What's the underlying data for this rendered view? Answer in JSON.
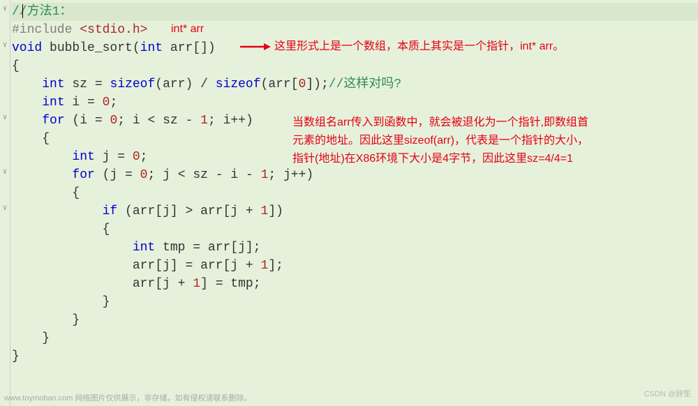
{
  "annotations": {
    "topLabel": "int* arr",
    "arrowNote": "这里形式上是一个数组，本质上其实是一个指针，int* arr。",
    "para1": "当数组名arr传入到函数中，就会被退化为一个指针,即数组首",
    "para2": "元素的地址。因此这里sizeof(arr)，代表是一个指针的大小，",
    "para3": "指针(地址)在X86环境下大小是4字节，因此这里sz=4/4=1"
  },
  "code": {
    "l1": {
      "a": "//方法1："
    },
    "l2": {
      "a": "#include ",
      "b": "<stdio.h>"
    },
    "l3": {
      "a": "void",
      "b": " bubble_sort",
      "c": "(",
      "d": "int",
      "e": " arr",
      "f": "[])"
    },
    "l4": {
      "a": "{"
    },
    "l5": {
      "a": "    ",
      "b": "int",
      "c": " sz ",
      "d": "=",
      "e": " ",
      "f": "sizeof",
      "g": "(arr) ",
      "h": "/",
      "i": " ",
      "j": "sizeof",
      "k": "(arr[",
      "l": "0",
      "m": "]);",
      "n": "//这样对吗?"
    },
    "l6": {
      "a": "    ",
      "b": "int",
      "c": " i ",
      "d": "=",
      "e": " ",
      "f": "0",
      "g": ";"
    },
    "l7": {
      "a": "    ",
      "b": "for",
      "c": " (i ",
      "d": "=",
      "e": " ",
      "f": "0",
      "g": "; i ",
      "h": "<",
      "i": " sz ",
      "j": "-",
      "k": " ",
      "l": "1",
      "m": "; i",
      "n": "++",
      "o": ")"
    },
    "l8": {
      "a": "    {"
    },
    "l9": {
      "a": "        ",
      "b": "int",
      "c": " j ",
      "d": "=",
      "e": " ",
      "f": "0",
      "g": ";"
    },
    "l10": {
      "a": "        ",
      "b": "for",
      "c": " (j ",
      "d": "=",
      "e": " ",
      "f": "0",
      "g": "; j ",
      "h": "<",
      "i": " sz ",
      "j": "-",
      "k": " i ",
      "l": "-",
      "m": " ",
      "n": "1",
      "o": "; j",
      "p": "++",
      "q": ")"
    },
    "l11": {
      "a": "        {"
    },
    "l12": {
      "a": "            ",
      "b": "if",
      "c": " (arr[j] ",
      "d": ">",
      "e": " arr[j ",
      "f": "+",
      "g": " ",
      "h": "1",
      "i": "])"
    },
    "l13": {
      "a": "            {"
    },
    "l14": {
      "a": "                ",
      "b": "int",
      "c": " tmp ",
      "d": "=",
      "e": " arr[j];"
    },
    "l15": {
      "a": "                arr[j] ",
      "b": "=",
      "c": " arr[j ",
      "d": "+",
      "e": " ",
      "f": "1",
      "g": "];"
    },
    "l16": {
      "a": "                arr[j ",
      "b": "+",
      "c": " ",
      "d": "1",
      "e": "] ",
      "f": "=",
      "g": " tmp;"
    },
    "l17": {
      "a": "            }"
    },
    "l18": {
      "a": "        }"
    },
    "l19": {
      "a": "    }"
    },
    "l20": {
      "a": "}"
    }
  },
  "watermark": "www.toymoban.com 网络图片仅供展示，非存储，如有侵权请联系删除。",
  "watermark2": "CSDN @辞笙"
}
